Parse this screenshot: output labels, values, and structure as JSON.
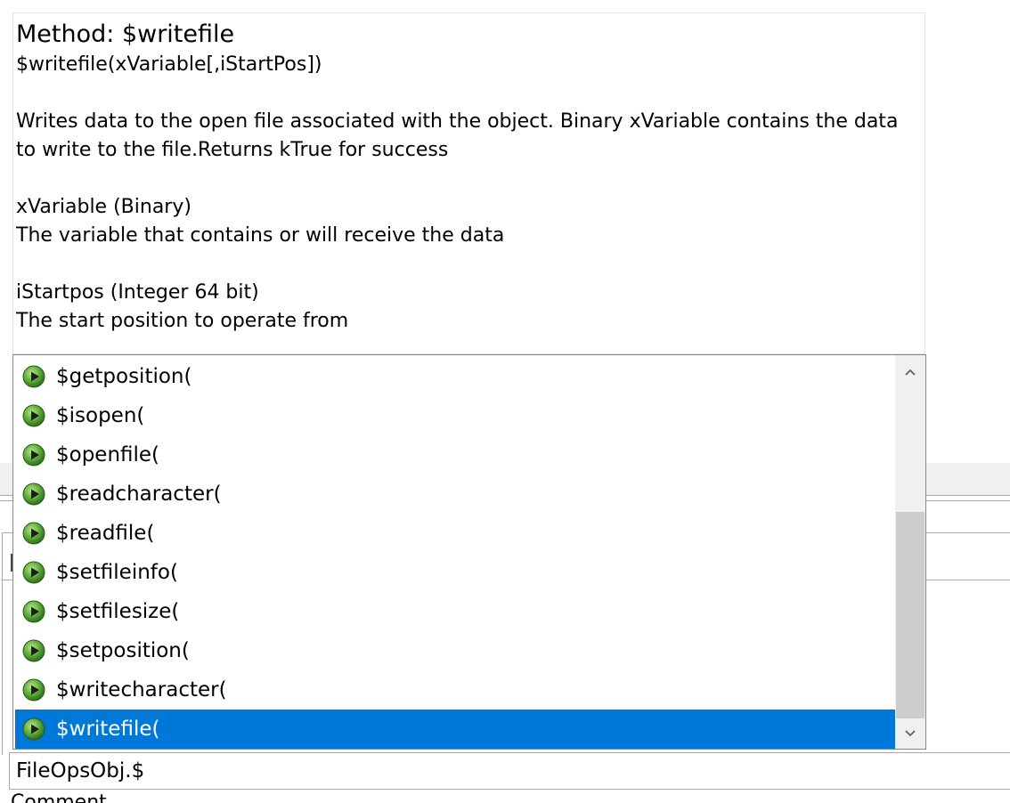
{
  "help": {
    "title": "Method: $writefile",
    "signature": "$writefile(xVariable[,iStartPos])",
    "description": "Writes data to the open file associated with the object. Binary xVariable contains the data to write to the file.Returns kTrue for success",
    "params": [
      {
        "name": "xVariable (Binary)",
        "description": "The variable that contains or will receive the data"
      },
      {
        "name": "iStartpos (Integer 64 bit)",
        "description": "The start position to operate from"
      }
    ]
  },
  "completion": {
    "items": [
      {
        "label": "$getposition(",
        "icon": "run-method-icon",
        "selected": false
      },
      {
        "label": "$isopen(",
        "icon": "run-method-icon",
        "selected": false
      },
      {
        "label": "$openfile(",
        "icon": "run-method-icon",
        "selected": false
      },
      {
        "label": "$readcharacter(",
        "icon": "run-method-icon",
        "selected": false
      },
      {
        "label": "$readfile(",
        "icon": "run-method-icon",
        "selected": false
      },
      {
        "label": "$setfileinfo(",
        "icon": "run-method-icon",
        "selected": false
      },
      {
        "label": "$setfilesize(",
        "icon": "run-method-icon",
        "selected": false
      },
      {
        "label": "$setposition(",
        "icon": "run-method-icon",
        "selected": false
      },
      {
        "label": "$writecharacter(",
        "icon": "run-method-icon",
        "selected": false
      },
      {
        "label": "$writefile(",
        "icon": "run-method-icon",
        "selected": true
      }
    ],
    "selected_color": "#0078d7",
    "scroll_position": 0.7
  },
  "editor": {
    "input_value": "FileOpsObj.$",
    "comment_label": "Comment"
  }
}
